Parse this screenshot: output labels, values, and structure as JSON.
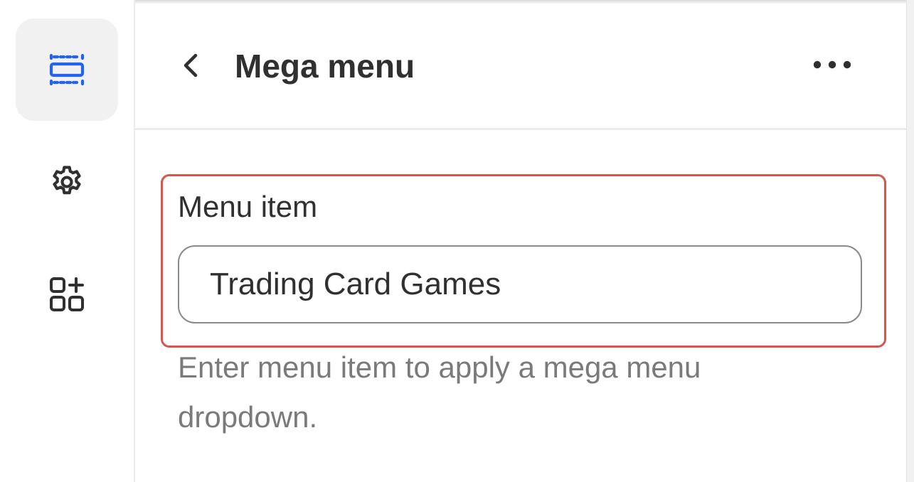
{
  "rail": {
    "items": [
      {
        "icon": "sections-icon",
        "active": true
      },
      {
        "icon": "gear-icon",
        "active": false
      },
      {
        "icon": "add-app-icon",
        "active": false
      }
    ]
  },
  "header": {
    "title": "Mega menu",
    "back_icon": "chevron-left-icon",
    "more_icon": "ellipsis-icon"
  },
  "field": {
    "label": "Menu item",
    "value": "Trading Card Games",
    "help": "Enter menu item to apply a mega menu dropdown."
  },
  "colors": {
    "accent": "#2463eb",
    "highlight": "#d9544a",
    "active_bg": "#f1f1f1"
  }
}
